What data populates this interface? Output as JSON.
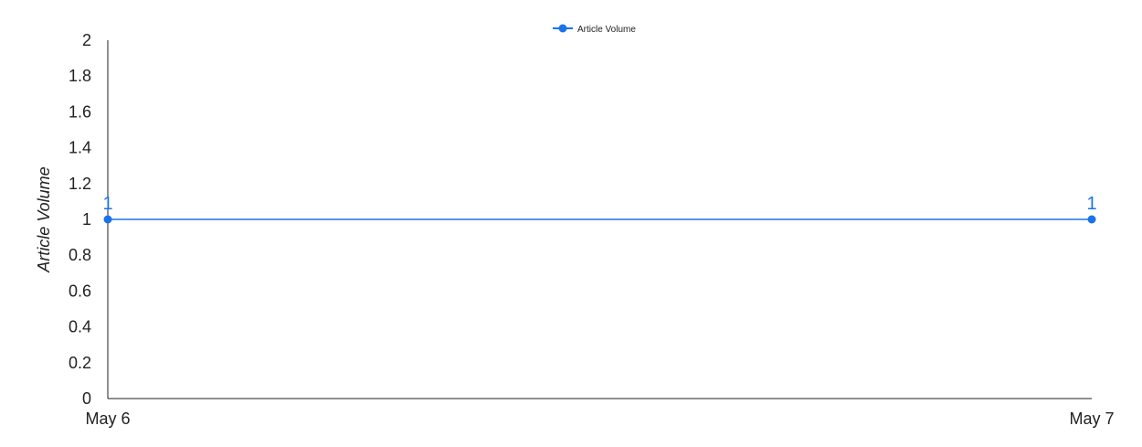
{
  "chart_data": {
    "type": "line",
    "categories": [
      "May 6",
      "May 7"
    ],
    "series": [
      {
        "name": "Article Volume",
        "values": [
          1,
          1
        ],
        "color": "#1a73e8"
      }
    ],
    "ylabel": "Article Volume",
    "xlabel": "",
    "ylim": [
      0,
      2
    ],
    "yticks": [
      "0",
      "0.2",
      "0.4",
      "0.6",
      "0.8",
      "1",
      "1.2",
      "1.4",
      "1.6",
      "1.8",
      "2"
    ],
    "data_labels": [
      "1",
      "1"
    ],
    "grid": false,
    "legend_position": "top-center",
    "axis_color": "#222222"
  }
}
